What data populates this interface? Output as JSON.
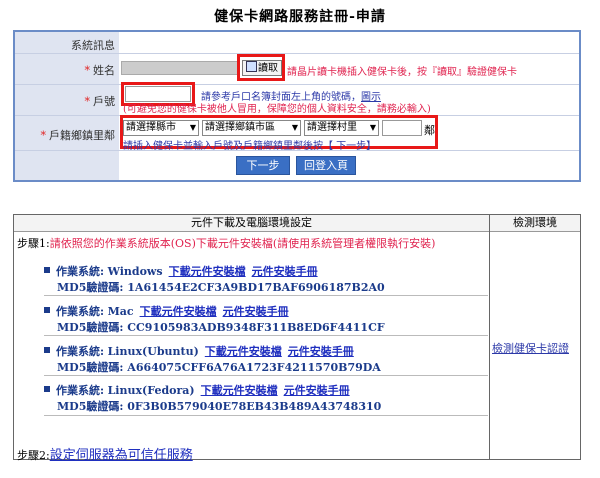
{
  "page": {
    "title": "健保卡網路服務註冊-申請"
  },
  "form": {
    "system_msg_label": "系統訊息",
    "name_label": "姓名",
    "read_button": "讀取",
    "read_hint": "請晶片讀卡機插入健保卡後，按『讀取』驗證健保卡",
    "household_label": "戶號",
    "household_hint1": "請參考戶口名簿封面左上角的號碼，",
    "household_hint_link": "圖示",
    "household_hint2": "(可避免您的健保卡被他人冒用，保障您的個人資料安全，請務必輸入)",
    "address_label": "戶籍鄉鎮里鄰",
    "select_city": "請選擇縣市",
    "select_town": "請選擇鄉鎮市區",
    "select_village": "請選擇村里",
    "neighborhood_suffix": "鄰",
    "address_hint": "請插入健保卡並輸入戶號及戶籍鄉鎮里鄰後按【 下一步】",
    "next_button": "下一步",
    "back_button": "回登入頁"
  },
  "download": {
    "header_left": "元件下載及電腦環境設定",
    "header_right": "檢測環境",
    "step1_prefix": "步驟1:",
    "step1_text": "請依照您的作業系統版本(OS)下載元件安裝檔(請使用系統管理者權限執行安裝)",
    "os_label": "作業系統:",
    "md5_label": "MD5驗證碼:",
    "download_link": "下載元件安裝檔",
    "manual_link": "元件安裝手冊",
    "os_list": [
      {
        "name": "Windows",
        "md5": "1A61454E2CF3A9BD17BAF6906187B2A0"
      },
      {
        "name": "Mac",
        "md5": "CC9105983ADB9348F311B8ED6F4411CF"
      },
      {
        "name": "Linux(Ubuntu)",
        "md5": "A664075CFF6A76A1723F4211570B79DA"
      },
      {
        "name": "Linux(Fedora)",
        "md5": "0F3B0B579040E78EB43B489A43748310"
      }
    ],
    "step2_prefix": "步驟2:",
    "step2_link": "設定伺服器為可信任服務",
    "check_link": "檢測健保卡認證"
  }
}
